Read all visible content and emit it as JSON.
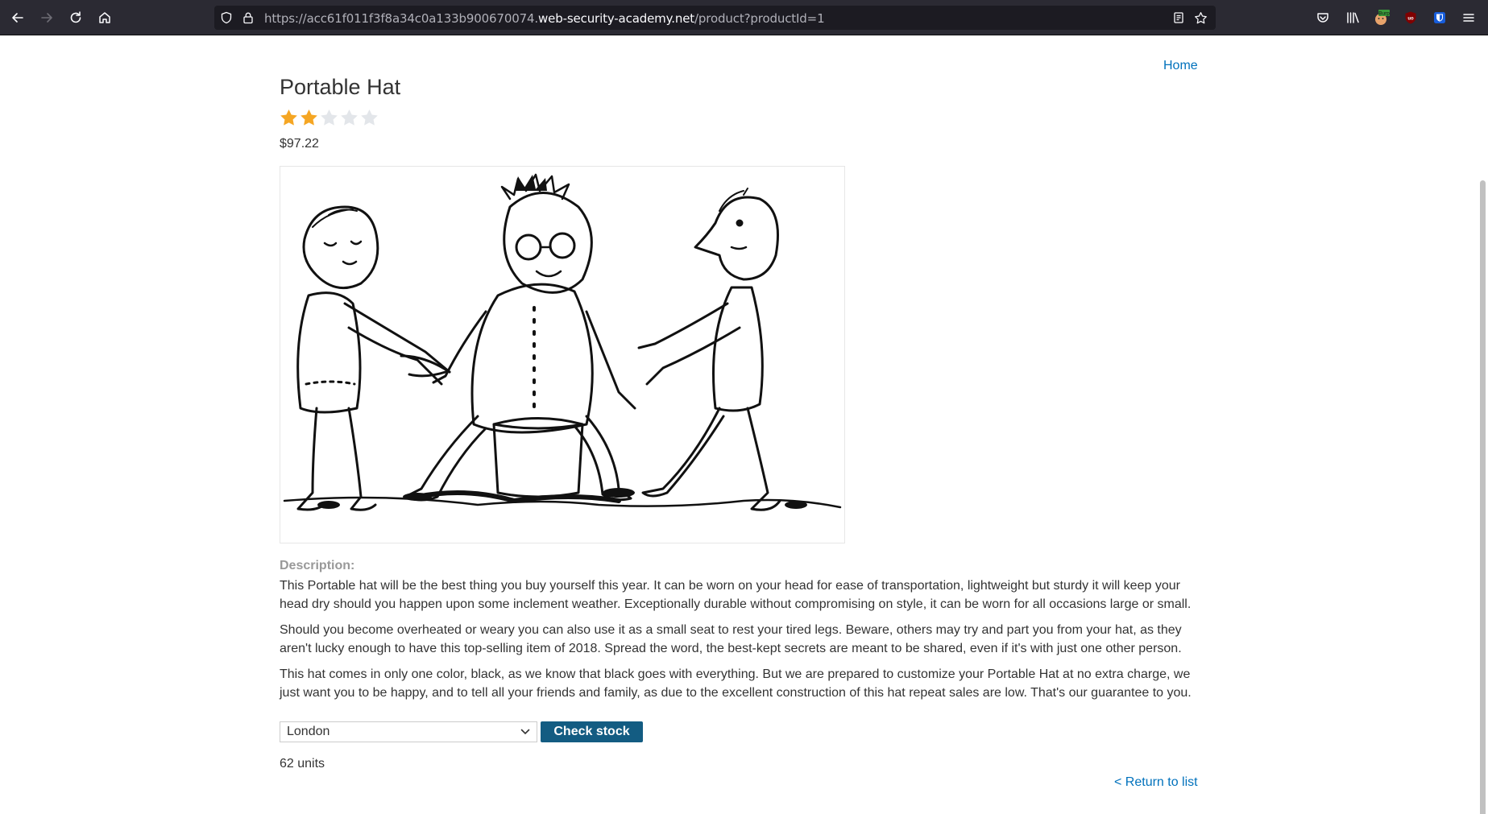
{
  "browser": {
    "url_prefix": "https://acc61f011f3f8a34c0a133b900670074.",
    "url_host": "web-security-academy.net",
    "url_path": "/product?productId=1",
    "extension_badge": "Burp"
  },
  "page": {
    "home_label": "Home",
    "title": "Portable Hat",
    "rating": {
      "value": 2,
      "max": 5
    },
    "price": "$97.22",
    "description_label": "Description:",
    "description": [
      "This Portable hat will be the best thing you buy yourself this year. It can be worn on your head for ease of transportation, lightweight but sturdy it will keep your head dry should you happen upon some inclement weather. Exceptionally durable without compromising on style, it can be worn for all occasions large or small.",
      "Should you become overheated or weary you can also use it as a small seat to rest your tired legs. Beware, others may try and part you from your hat, as they aren't lucky enough to have this top-selling item of 2018. Spread the word, the best-kept secrets are meant to be shared, even if it's with just one other person.",
      "This hat comes in only one color, black, as we know that black goes with everything. But we are prepared to customize your Portable Hat at no extra charge, we just want you to be happy, and to tell all your friends and family, as due to the excellent construction of this hat repeat sales are low. That's our guarantee to you."
    ],
    "stock_select_value": "London",
    "check_stock_label": "Check stock",
    "stock_result": "62 units",
    "return_label": "< Return to list"
  },
  "colors": {
    "link": "#0071bc",
    "button": "#135c82",
    "star_filled": "#f5a623",
    "star_empty": "#e3e6ea"
  }
}
